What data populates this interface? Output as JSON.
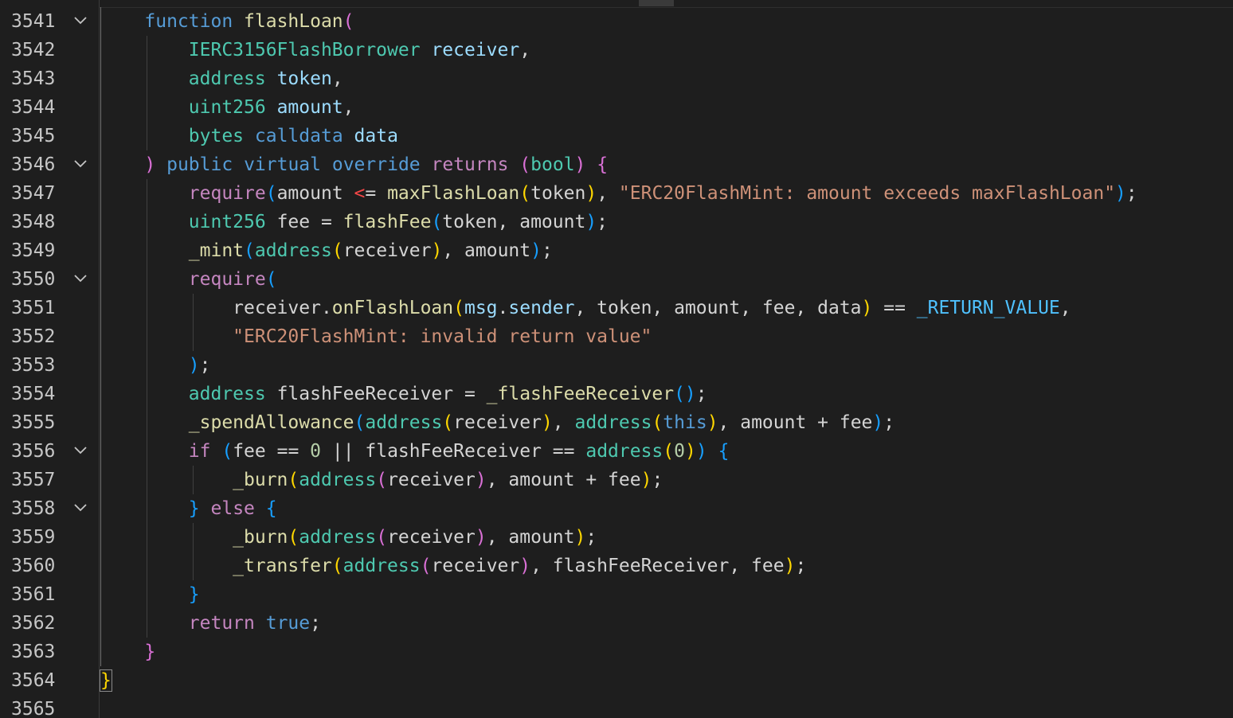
{
  "editor": {
    "language": "solidity",
    "colors": {
      "background": "#1e1e1e",
      "line_number": "#c6c6c6",
      "keyword": "#569cd6",
      "control_keyword": "#c586c0",
      "type": "#4ec9b0",
      "function": "#dcdcaa",
      "string": "#ce9178",
      "bracket_level_1": "#ffd700",
      "bracket_level_2": "#da70d6",
      "bracket_level_3": "#179fff"
    },
    "fold_icon": "chevron-down-icon"
  },
  "lines": [
    {
      "number": "3541",
      "foldable": true,
      "tokens": [
        [
          "",
          "    "
        ],
        [
          "kw",
          "function"
        ],
        [
          "plain",
          " "
        ],
        [
          "fn",
          "flashLoan"
        ],
        [
          "b2",
          "("
        ]
      ]
    },
    {
      "number": "3542",
      "foldable": false,
      "tokens": [
        [
          "",
          "        "
        ],
        [
          "ty",
          "IERC3156FlashBorrower"
        ],
        [
          "plain",
          " "
        ],
        [
          "var",
          "receiver"
        ],
        [
          "plain",
          ","
        ]
      ]
    },
    {
      "number": "3543",
      "foldable": false,
      "tokens": [
        [
          "",
          "        "
        ],
        [
          "ty",
          "address"
        ],
        [
          "plain",
          " "
        ],
        [
          "var",
          "token"
        ],
        [
          "plain",
          ","
        ]
      ]
    },
    {
      "number": "3544",
      "foldable": false,
      "tokens": [
        [
          "",
          "        "
        ],
        [
          "ty",
          "uint256"
        ],
        [
          "plain",
          " "
        ],
        [
          "var",
          "amount"
        ],
        [
          "plain",
          ","
        ]
      ]
    },
    {
      "number": "3545",
      "foldable": false,
      "tokens": [
        [
          "",
          "        "
        ],
        [
          "ty",
          "bytes"
        ],
        [
          "plain",
          " "
        ],
        [
          "kw",
          "calldata"
        ],
        [
          "plain",
          " "
        ],
        [
          "var",
          "data"
        ]
      ]
    },
    {
      "number": "3546",
      "foldable": true,
      "tokens": [
        [
          "",
          "    "
        ],
        [
          "b2",
          ")"
        ],
        [
          "plain",
          " "
        ],
        [
          "kw",
          "public"
        ],
        [
          "plain",
          " "
        ],
        [
          "kw",
          "virtual"
        ],
        [
          "plain",
          " "
        ],
        [
          "kw",
          "override"
        ],
        [
          "plain",
          " "
        ],
        [
          "kw2",
          "returns"
        ],
        [
          "plain",
          " "
        ],
        [
          "b2",
          "("
        ],
        [
          "ty",
          "bool"
        ],
        [
          "b2",
          ")"
        ],
        [
          "plain",
          " "
        ],
        [
          "b2",
          "{"
        ]
      ]
    },
    {
      "number": "3547",
      "foldable": false,
      "tokens": [
        [
          "",
          "        "
        ],
        [
          "kw2",
          "require"
        ],
        [
          "b3",
          "("
        ],
        [
          "plain",
          "amount "
        ],
        [
          "op-red",
          "<"
        ],
        [
          "plain",
          "= "
        ],
        [
          "fn",
          "maxFlashLoan"
        ],
        [
          "b1",
          "("
        ],
        [
          "plain",
          "token"
        ],
        [
          "b1",
          ")"
        ],
        [
          "plain",
          ", "
        ],
        [
          "str",
          "\"ERC20FlashMint: amount exceeds maxFlashLoan\""
        ],
        [
          "b3",
          ")"
        ],
        [
          "plain",
          ";"
        ]
      ]
    },
    {
      "number": "3548",
      "foldable": false,
      "tokens": [
        [
          "",
          "        "
        ],
        [
          "ty",
          "uint256"
        ],
        [
          "plain",
          " fee = "
        ],
        [
          "fn",
          "flashFee"
        ],
        [
          "b3",
          "("
        ],
        [
          "plain",
          "token, amount"
        ],
        [
          "b3",
          ")"
        ],
        [
          "plain",
          ";"
        ]
      ]
    },
    {
      "number": "3549",
      "foldable": false,
      "tokens": [
        [
          "",
          "        "
        ],
        [
          "fn",
          "_mint"
        ],
        [
          "b3",
          "("
        ],
        [
          "ty",
          "address"
        ],
        [
          "b1",
          "("
        ],
        [
          "plain",
          "receiver"
        ],
        [
          "b1",
          ")"
        ],
        [
          "plain",
          ", amount"
        ],
        [
          "b3",
          ")"
        ],
        [
          "plain",
          ";"
        ]
      ]
    },
    {
      "number": "3550",
      "foldable": true,
      "tokens": [
        [
          "",
          "        "
        ],
        [
          "kw2",
          "require"
        ],
        [
          "b3",
          "("
        ]
      ]
    },
    {
      "number": "3551",
      "foldable": false,
      "tokens": [
        [
          "",
          "            "
        ],
        [
          "plain",
          "receiver."
        ],
        [
          "fn",
          "onFlashLoan"
        ],
        [
          "b1",
          "("
        ],
        [
          "var",
          "msg"
        ],
        [
          "plain",
          "."
        ],
        [
          "var",
          "sender"
        ],
        [
          "plain",
          ", token, amount, fee, data"
        ],
        [
          "b1",
          ")"
        ],
        [
          "plain",
          " == "
        ],
        [
          "const",
          "_RETURN_VALUE"
        ],
        [
          "plain",
          ","
        ]
      ]
    },
    {
      "number": "3552",
      "foldable": false,
      "tokens": [
        [
          "",
          "            "
        ],
        [
          "str",
          "\"ERC20FlashMint: invalid return value\""
        ]
      ]
    },
    {
      "number": "3553",
      "foldable": false,
      "tokens": [
        [
          "",
          "        "
        ],
        [
          "b3",
          ")"
        ],
        [
          "plain",
          ";"
        ]
      ]
    },
    {
      "number": "3554",
      "foldable": false,
      "tokens": [
        [
          "",
          "        "
        ],
        [
          "ty",
          "address"
        ],
        [
          "plain",
          " flashFeeReceiver = "
        ],
        [
          "fn",
          "_flashFeeReceiver"
        ],
        [
          "b3",
          "()"
        ],
        [
          "plain",
          ";"
        ]
      ]
    },
    {
      "number": "3555",
      "foldable": false,
      "tokens": [
        [
          "",
          "        "
        ],
        [
          "fn",
          "_spendAllowance"
        ],
        [
          "b3",
          "("
        ],
        [
          "ty",
          "address"
        ],
        [
          "b1",
          "("
        ],
        [
          "plain",
          "receiver"
        ],
        [
          "b1",
          ")"
        ],
        [
          "plain",
          ", "
        ],
        [
          "ty",
          "address"
        ],
        [
          "b1",
          "("
        ],
        [
          "kw",
          "this"
        ],
        [
          "b1",
          ")"
        ],
        [
          "plain",
          ", amount + fee"
        ],
        [
          "b3",
          ")"
        ],
        [
          "plain",
          ";"
        ]
      ]
    },
    {
      "number": "3556",
      "foldable": true,
      "tokens": [
        [
          "",
          "        "
        ],
        [
          "kw2",
          "if"
        ],
        [
          "plain",
          " "
        ],
        [
          "b3",
          "("
        ],
        [
          "plain",
          "fee == "
        ],
        [
          "num",
          "0"
        ],
        [
          "plain",
          " || flashFeeReceiver == "
        ],
        [
          "ty",
          "address"
        ],
        [
          "b1",
          "("
        ],
        [
          "num",
          "0"
        ],
        [
          "b1",
          ")"
        ],
        [
          "b3",
          ")"
        ],
        [
          "plain",
          " "
        ],
        [
          "b3",
          "{"
        ]
      ]
    },
    {
      "number": "3557",
      "foldable": false,
      "tokens": [
        [
          "",
          "            "
        ],
        [
          "fn",
          "_burn"
        ],
        [
          "b1",
          "("
        ],
        [
          "ty",
          "address"
        ],
        [
          "b2",
          "("
        ],
        [
          "plain",
          "receiver"
        ],
        [
          "b2",
          ")"
        ],
        [
          "plain",
          ", amount + fee"
        ],
        [
          "b1",
          ")"
        ],
        [
          "plain",
          ";"
        ]
      ]
    },
    {
      "number": "3558",
      "foldable": true,
      "tokens": [
        [
          "",
          "        "
        ],
        [
          "b3",
          "}"
        ],
        [
          "plain",
          " "
        ],
        [
          "kw2",
          "else"
        ],
        [
          "plain",
          " "
        ],
        [
          "b3",
          "{"
        ]
      ]
    },
    {
      "number": "3559",
      "foldable": false,
      "tokens": [
        [
          "",
          "            "
        ],
        [
          "fn",
          "_burn"
        ],
        [
          "b1",
          "("
        ],
        [
          "ty",
          "address"
        ],
        [
          "b2",
          "("
        ],
        [
          "plain",
          "receiver"
        ],
        [
          "b2",
          ")"
        ],
        [
          "plain",
          ", amount"
        ],
        [
          "b1",
          ")"
        ],
        [
          "plain",
          ";"
        ]
      ]
    },
    {
      "number": "3560",
      "foldable": false,
      "tokens": [
        [
          "",
          "            "
        ],
        [
          "fn",
          "_transfer"
        ],
        [
          "b1",
          "("
        ],
        [
          "ty",
          "address"
        ],
        [
          "b2",
          "("
        ],
        [
          "plain",
          "receiver"
        ],
        [
          "b2",
          ")"
        ],
        [
          "plain",
          ", flashFeeReceiver, fee"
        ],
        [
          "b1",
          ")"
        ],
        [
          "plain",
          ";"
        ]
      ]
    },
    {
      "number": "3561",
      "foldable": false,
      "tokens": [
        [
          "",
          "        "
        ],
        [
          "b3",
          "}"
        ]
      ]
    },
    {
      "number": "3562",
      "foldable": false,
      "tokens": [
        [
          "",
          "        "
        ],
        [
          "kw2",
          "return"
        ],
        [
          "plain",
          " "
        ],
        [
          "kw",
          "true"
        ],
        [
          "plain",
          ";"
        ]
      ]
    },
    {
      "number": "3563",
      "foldable": false,
      "tokens": [
        [
          "",
          "    "
        ],
        [
          "b2",
          "}"
        ]
      ]
    },
    {
      "number": "3564",
      "foldable": false,
      "tokens": [
        [
          "b1 cursor",
          "}"
        ]
      ]
    },
    {
      "number": "3565",
      "foldable": false,
      "tokens": []
    }
  ]
}
